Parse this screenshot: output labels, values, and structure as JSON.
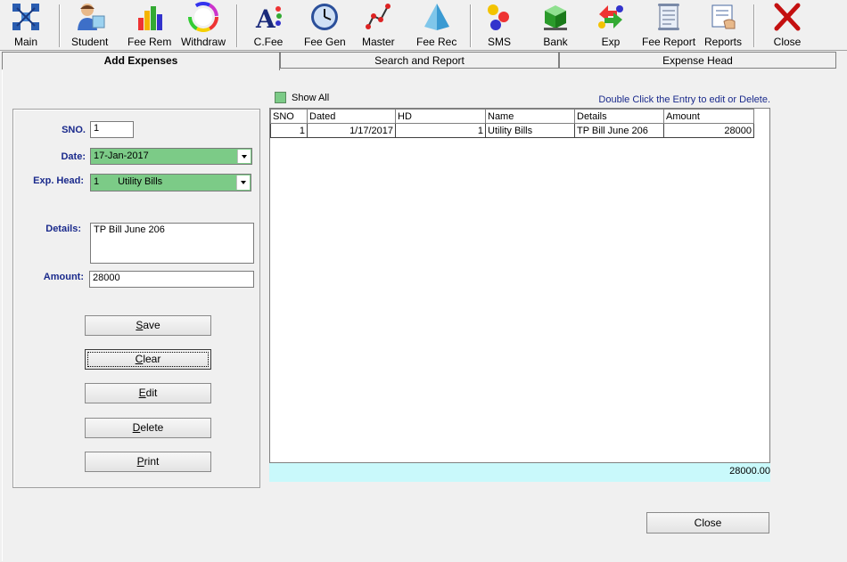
{
  "toolbar": {
    "items": [
      {
        "label": "Main",
        "icon": "grid-icon"
      },
      {
        "label": "Student",
        "icon": "student-icon"
      },
      {
        "label": "Fee Rem",
        "icon": "bar-chart-icon"
      },
      {
        "label": "Withdraw",
        "icon": "color-wheel-icon"
      },
      {
        "label": "C.Fee",
        "icon": "letter-a-icon"
      },
      {
        "label": "Fee Gen",
        "icon": "clock-icon"
      },
      {
        "label": "Master",
        "icon": "line-chart-icon"
      },
      {
        "label": "Fee Rec",
        "icon": "pyramid-icon"
      },
      {
        "label": "SMS",
        "icon": "balls-icon"
      },
      {
        "label": "Bank",
        "icon": "green-cube-icon"
      },
      {
        "label": "Exp",
        "icon": "recycle-arrows-icon"
      },
      {
        "label": "Fee Report",
        "icon": "scroll-icon"
      },
      {
        "label": "Reports",
        "icon": "report-hand-icon"
      },
      {
        "label": "Close",
        "icon": "red-x-icon"
      }
    ]
  },
  "tabs": [
    "Add Expenses",
    "Search and Report",
    "Expense Head"
  ],
  "form": {
    "sno_label": "SNO.",
    "sno_value": "1",
    "date_label": "Date:",
    "date_value": "17-Jan-2017",
    "exp_head_label": "Exp. Head:",
    "exp_head_code": "1",
    "exp_head_value": "Utility Bills",
    "details_label": "Details:",
    "details_value": "TP Bill June 206",
    "amount_label": "Amount:",
    "amount_value": "28000"
  },
  "buttons": {
    "save_hotkey": "S",
    "save_rest": "ave",
    "clear_hotkey": "C",
    "clear_rest": "lear",
    "edit_hotkey": "E",
    "edit_rest": "dit",
    "delete_hotkey": "D",
    "delete_rest": "elete",
    "print_hotkey": "P",
    "print_rest": "rint",
    "close": "Close"
  },
  "grid": {
    "show_all": "Show All",
    "hint": "Double Click the Entry to edit or Delete.",
    "columns": [
      "SNO",
      "Dated",
      "HD",
      "Name",
      "Details",
      "Amount"
    ],
    "rows": [
      [
        "1",
        "1/17/2017",
        "1",
        "Utility Bills",
        "TP Bill June 206",
        "28000"
      ]
    ],
    "total": "28000.00"
  },
  "colors": {
    "label_blue": "#1a2a8c",
    "combo_green": "#7ccb87",
    "total_cyan": "#c9f9fb"
  }
}
